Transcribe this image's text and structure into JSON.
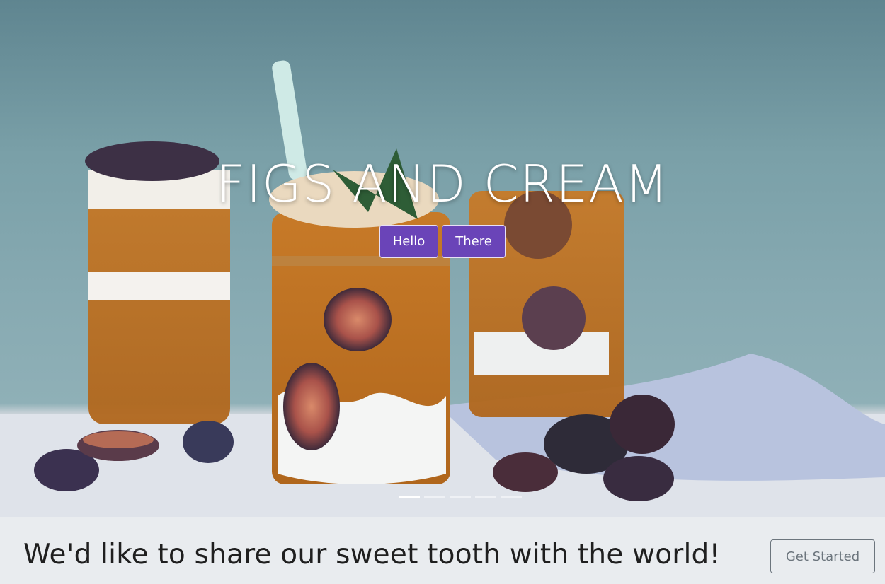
{
  "hero": {
    "title": "FIGS AND CREAM",
    "buttons": {
      "hello": "Hello",
      "there": "There"
    },
    "slides_count": 5,
    "active_slide": 1,
    "button_color": "#6a44b8"
  },
  "banner": {
    "text": "We'd like to share our sweet tooth with the world!",
    "cta_label": "Get Started"
  }
}
